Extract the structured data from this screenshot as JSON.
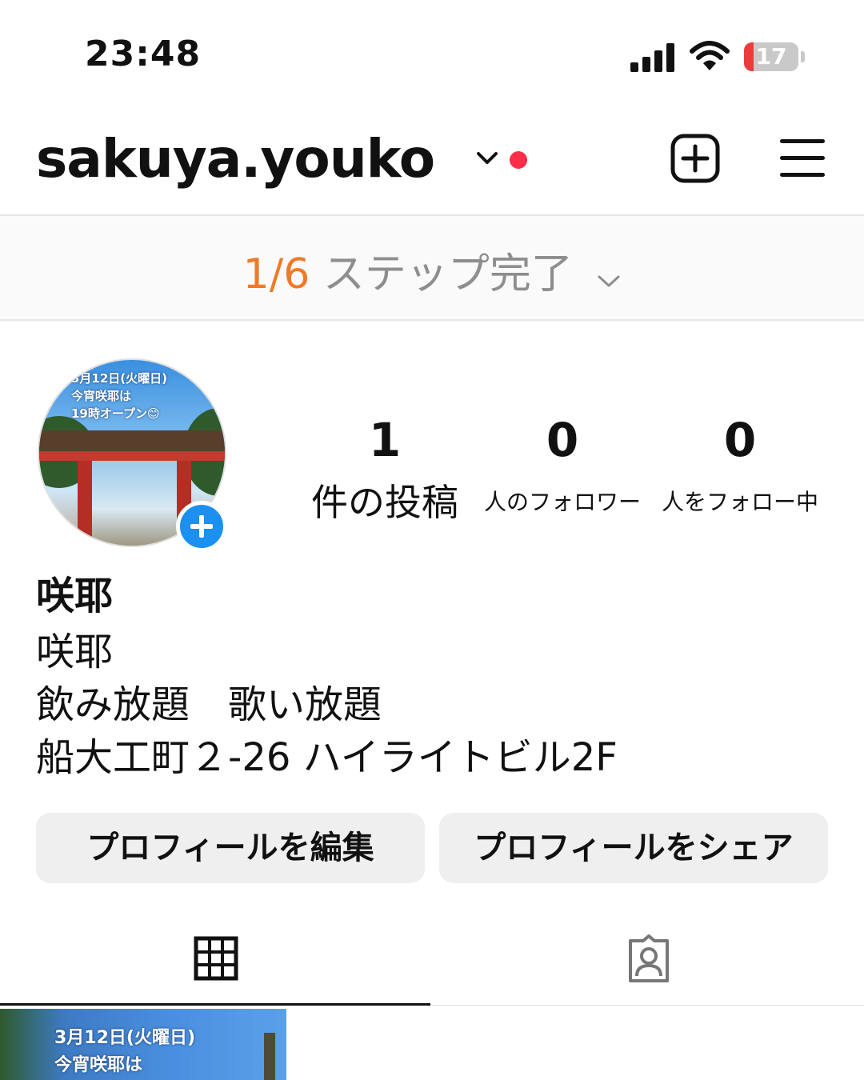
{
  "status_bar": {
    "time": "23:48",
    "battery_level": "17",
    "icons": [
      "cellular-signal-icon",
      "wifi-icon",
      "battery-icon"
    ]
  },
  "header": {
    "username": "sakuya.youko",
    "icons": [
      "chevron-down-icon",
      "notification-dot",
      "create-post-icon",
      "hamburger-menu-icon"
    ],
    "accent_dot_color": "#ff2d46"
  },
  "steps": {
    "count": "1/6",
    "label": "ステップ完了",
    "count_color": "#f07a2a"
  },
  "profile": {
    "avatar_caption": [
      "3月12日(火曜日)",
      "今宵咲耶は",
      "19時オープン😊"
    ],
    "stats": {
      "posts": {
        "value": "1",
        "label": "件の投稿"
      },
      "followers": {
        "value": "0",
        "label": "人のフォロワー"
      },
      "following": {
        "value": "0",
        "label": "人をフォロー中"
      }
    },
    "name": "咲耶",
    "bio_lines": [
      "咲耶",
      "飲み放題　歌い放題",
      "船大工町２-26 ハイライトビル2F"
    ]
  },
  "buttons": {
    "edit": "プロフィールを編集",
    "share": "プロフィールをシェア"
  },
  "tabs": {
    "icons": [
      "grid-icon",
      "tagged-photos-icon"
    ],
    "active": "grid"
  },
  "posts": [
    {
      "caption_lines": [
        "3月12日(火曜日)",
        "今宵咲耶は"
      ]
    }
  ]
}
